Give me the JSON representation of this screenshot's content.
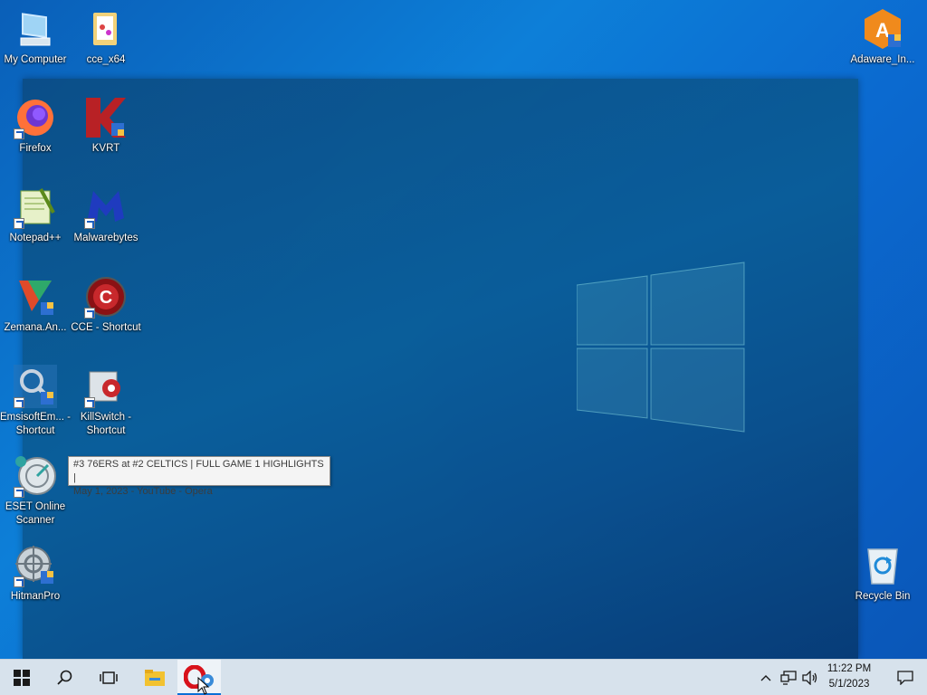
{
  "desktop": {
    "icons": {
      "my_computer": {
        "label": "My Computer",
        "icon": "monitor-icon"
      },
      "cce_x64": {
        "label": "cce_x64",
        "icon": "folder-icon"
      },
      "adaware": {
        "label": "Adaware_In...",
        "icon": "adaware-icon"
      },
      "firefox": {
        "label": "Firefox",
        "icon": "firefox-icon"
      },
      "kvrt": {
        "label": "KVRT",
        "icon": "kvrt-icon"
      },
      "notepadpp": {
        "label": "Notepad++",
        "icon": "notepad-plus-plus-icon"
      },
      "malwarebytes": {
        "label": "Malwarebytes",
        "icon": "malwarebytes-icon"
      },
      "zemana": {
        "label": "Zemana.An...",
        "icon": "zemana-icon"
      },
      "cce_shortcut": {
        "label": "CCE - Shortcut",
        "icon": "cce-icon"
      },
      "emsisoft": {
        "label": "EmsisoftEm... - Shortcut",
        "icon": "emsisoft-icon"
      },
      "killswitch": {
        "label": "KillSwitch - Shortcut",
        "icon": "killswitch-icon"
      },
      "eset": {
        "label": "ESET Online Scanner",
        "icon": "eset-icon"
      },
      "hitmanpro": {
        "label": "HitmanPro",
        "icon": "hitmanpro-icon"
      },
      "recycle_bin": {
        "label": "Recycle Bin",
        "icon": "recycle-bin-icon"
      }
    },
    "tooltip": {
      "line1": "#3 76ERS at #2 CELTICS | FULL GAME 1 HIGHLIGHTS |",
      "line2": "May 1, 2023 - YouTube - Opera"
    }
  },
  "taskbar": {
    "start": "windows-start-icon",
    "search": "search-icon",
    "task_view": "task-view-icon",
    "pinned": [
      {
        "name": "File Explorer",
        "icon": "file-explorer-icon"
      },
      {
        "name": "Opera",
        "icon": "opera-icon",
        "active": true
      }
    ],
    "tray": {
      "chevron": "chevron-up-icon",
      "network": "network-icon",
      "volume": "volume-icon"
    },
    "clock": {
      "time": "11:22 PM",
      "date": "5/1/2023"
    },
    "notifications": "notification-icon"
  },
  "colors": {
    "desktop_bg": "#0b6ad0",
    "taskbar_bg": "#d7e2ec",
    "accent": "#0a6fd6"
  }
}
